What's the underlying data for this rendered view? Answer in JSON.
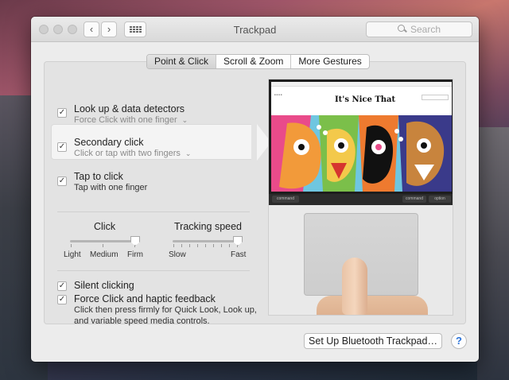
{
  "window": {
    "title": "Trackpad",
    "search_placeholder": "Search"
  },
  "nav": {
    "back": "‹",
    "forward": "›"
  },
  "tabs": [
    {
      "label": "Point & Click",
      "active": true
    },
    {
      "label": "Scroll & Zoom",
      "active": false
    },
    {
      "label": "More Gestures",
      "active": false
    }
  ],
  "options": {
    "lookup": {
      "title": "Look up & data detectors",
      "subtitle": "Force Click with one finger",
      "checked": true
    },
    "secondary": {
      "title": "Secondary click",
      "subtitle": "Click or tap with two fingers",
      "checked": true
    },
    "tap": {
      "title": "Tap to click",
      "subtitle": "Tap with one finger",
      "checked": true
    },
    "silent": {
      "title": "Silent clicking",
      "checked": true
    },
    "force": {
      "title": "Force Click and haptic feedback",
      "description": "Click then press firmly for Quick Look, Look up, and variable speed media controls.",
      "checked": true
    }
  },
  "sliders": {
    "click": {
      "label": "Click",
      "ticks": [
        "Light",
        "Medium",
        "Firm"
      ],
      "value_fraction": 1.0
    },
    "tracking": {
      "label": "Tracking speed",
      "ticks": [
        "Slow",
        "Fast"
      ],
      "value_fraction": 1.0
    }
  },
  "preview": {
    "site_logo": "It's Nice That",
    "keys": [
      "command",
      "command",
      "option"
    ]
  },
  "footer": {
    "setup_button": "Set Up Bluetooth Trackpad…",
    "help": "?"
  },
  "check_glyph": "✓",
  "caret_glyph": "⌄"
}
